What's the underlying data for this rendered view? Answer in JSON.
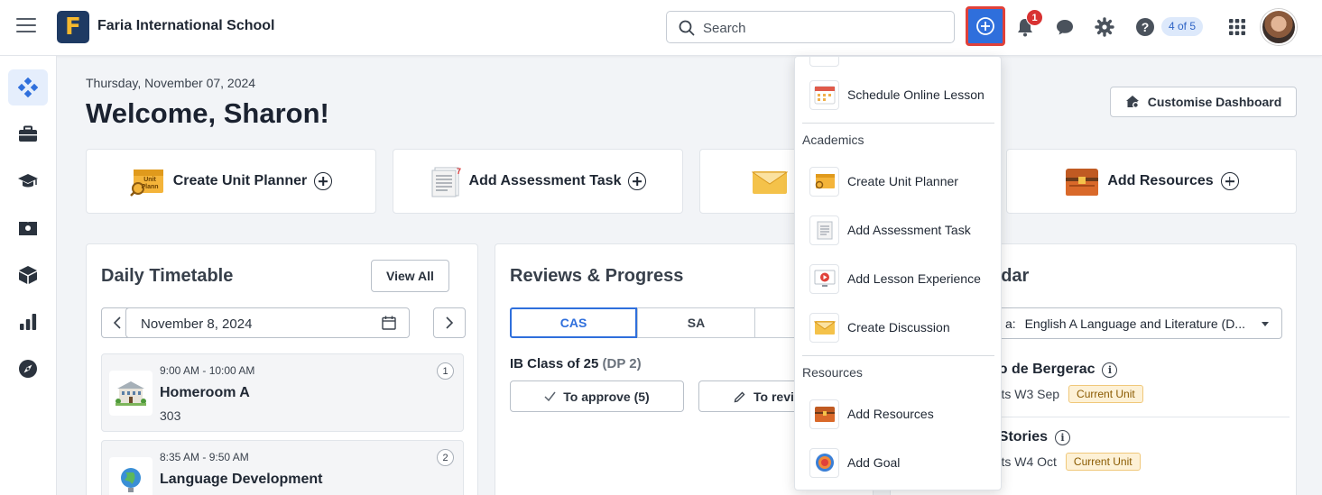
{
  "topbar": {
    "school_name": "Faria International School",
    "logo_letter": "F",
    "search_placeholder": "Search",
    "notification_count": "1",
    "help_progress": "4 of 5",
    "colors": {
      "accent": "#2f6fdc",
      "highlight_border": "#e0413a",
      "badge": "#d83232"
    }
  },
  "sidebar": {
    "items": [
      {
        "icon": "dashboard-icon",
        "active": true
      },
      {
        "icon": "briefcase-icon"
      },
      {
        "icon": "graduation-cap-icon"
      },
      {
        "icon": "book-icon"
      },
      {
        "icon": "cube-icon"
      },
      {
        "icon": "bar-chart-icon"
      },
      {
        "icon": "compass-icon"
      }
    ]
  },
  "header": {
    "date": "Thursday, November 07, 2024",
    "welcome": "Welcome, Sharon!",
    "customise_label": "Customise Dashboard"
  },
  "quick_actions": [
    {
      "label": "Create Unit Planner",
      "icon": "unit-planner-icon"
    },
    {
      "label": "Add Assessment Task",
      "icon": "assessment-task-icon"
    },
    {
      "label": "",
      "icon": "discussion-envelope-icon"
    },
    {
      "label": "Add Resources",
      "icon": "resources-chest-icon"
    }
  ],
  "timetable": {
    "title": "Daily Timetable",
    "view_all": "View All",
    "date": "November 8, 2024",
    "items": [
      {
        "time": "9:00 AM - 10:00 AM",
        "title": "Homeroom A",
        "room": "303",
        "num": "1"
      },
      {
        "time": "8:35 AM - 9:50 AM",
        "title": "Language Development",
        "num": "2"
      }
    ]
  },
  "reviews": {
    "title": "Reviews & Progress",
    "tabs": [
      "CAS",
      "SA"
    ],
    "class_name": "IB Class of 25",
    "class_suffix": "(DP 2)",
    "to_approve": "To approve (5)",
    "to_review": "To revi"
  },
  "calendar": {
    "title": "ndar",
    "select_prefix": "a:",
    "select_value": "English A Language and Literature (D...",
    "entries": [
      {
        "title": "no de Bergerac",
        "sub": "arts W3 Sep",
        "badge": "Current Unit"
      },
      {
        "title": "t Stories",
        "sub": "arts W4 Oct",
        "badge": "Current Unit"
      }
    ]
  },
  "dropdown": {
    "top_item": "Schedule Online Lesson",
    "sections": [
      {
        "header": "Academics",
        "items": [
          "Create Unit Planner",
          "Add Assessment Task",
          "Add Lesson Experience",
          "Create Discussion"
        ]
      },
      {
        "header": "Resources",
        "items": [
          "Add Resources",
          "Add Goal"
        ]
      }
    ]
  }
}
